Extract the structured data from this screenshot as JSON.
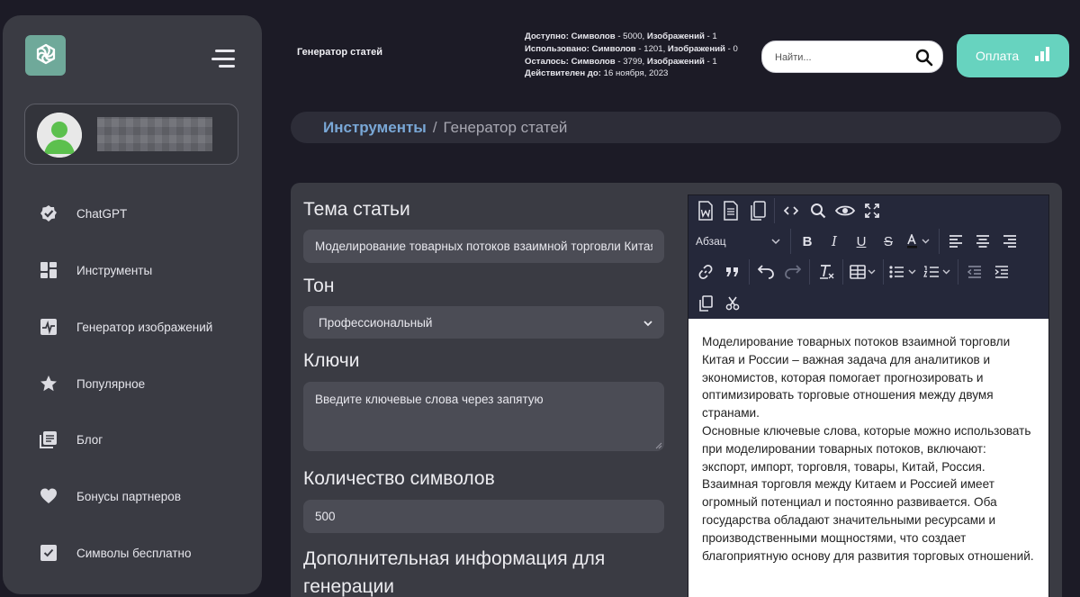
{
  "header": {
    "page_name": "Генератор статей",
    "stats": [
      {
        "label": "Доступно: Символов",
        "v1": " - 5000, ",
        "label2": "Изображений",
        "v2": " - 1"
      },
      {
        "label": "Использовано: Символов",
        "v1": " - 1201, ",
        "label2": "Изображений",
        "v2": " - 0"
      },
      {
        "label": "Осталось: Символов",
        "v1": " - 3799, ",
        "label2": "Изображений",
        "v2": " - 1"
      },
      {
        "label": "Действителен до:",
        "v1": " 16 ноября, 2023",
        "label2": "",
        "v2": ""
      }
    ],
    "search_placeholder": "Найти...",
    "pay_label": "Оплата"
  },
  "sidebar": {
    "items": [
      {
        "label": "ChatGPT",
        "icon": "check-badge-icon"
      },
      {
        "label": "Инструменты",
        "icon": "grid-icon"
      },
      {
        "label": "Генератор изображений",
        "icon": "pulse-image-icon"
      },
      {
        "label": "Популярное",
        "icon": "star-icon"
      },
      {
        "label": "Блог",
        "icon": "blog-icon"
      },
      {
        "label": "Бонусы партнеров",
        "icon": "heart-icon"
      },
      {
        "label": "Символы бесплатно",
        "icon": "checkbox-icon"
      }
    ]
  },
  "breadcrumb": {
    "link": "Инструменты",
    "separator": "/",
    "current": "Генератор статей"
  },
  "form": {
    "topic_label": "Тема статьи",
    "topic_value": "Моделирование товарных потоков взаимной торговли Китая и России",
    "tone_label": "Тон",
    "tone_value": "Профессиональный",
    "keys_label": "Ключи",
    "keys_placeholder": "Введите ключевые слова через запятую",
    "chars_label": "Количество символов",
    "chars_value": "500",
    "extra_label": "Дополнительная информация для генерации"
  },
  "editor": {
    "format_select": "Абзац",
    "paragraphs": [
      "Моделирование товарных потоков взаимной торговли Китая и России – важная задача для аналитиков и экономистов, которая помогает прогнозировать и оптимизировать торговые отношения между двумя странами.",
      "Основные ключевые слова, которые можно использовать при моделировании товарных потоков, включают: экспорт, импорт, торговля, товары, Китай, Россия.",
      "Взаимная торговля между Китаем и Россией имеет огромный потенциал и постоянно развивается. Оба государства обладают значительными ресурсами и производственными мощностями, что создает благоприятную основу для развития торговых отношений."
    ]
  },
  "colors": {
    "background": "#1c1b26",
    "sidebar": "#3a3b43",
    "accent": "#67d3bf",
    "link": "#79a7d6",
    "toolbar": "#25283a"
  }
}
